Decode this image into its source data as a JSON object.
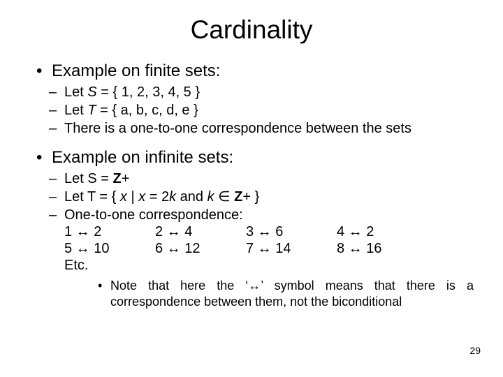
{
  "title": "Cardinality",
  "bullet1": "Example on finite sets:",
  "sub1a_pre": "Let ",
  "sub1a_S": "S",
  "sub1a_post": " = { 1, 2, 3, 4, 5 }",
  "sub1b_pre": "Let ",
  "sub1b_T": "T",
  "sub1b_post": " = { a, b, c, d, e }",
  "sub1c": "There is a one-to-one correspondence between the sets",
  "bullet2": "Example on infinite sets:",
  "sub2a_pre": "Let S = ",
  "sub2a_Z": "Z",
  "sub2a_post": "+",
  "sub2b_pre": "Let T = { ",
  "sub2b_x": "x",
  "sub2b_mid1": " | ",
  "sub2b_x2": "x",
  "sub2b_mid2": " = 2",
  "sub2b_k": "k",
  "sub2b_mid3": " and ",
  "sub2b_k2": "k",
  "sub2b_in": " ∈ ",
  "sub2b_Z": "Z",
  "sub2b_post": "+ }",
  "sub2c": "One-to-one correspondence:",
  "map": {
    "r1c1": "1 ↔ 2",
    "r1c2": "2 ↔ 4",
    "r1c3": "3 ↔ 6",
    "r1c4": "4 ↔ 2",
    "r2c1": "5 ↔ 10",
    "r2c2": "6 ↔ 12",
    "r2c3": "7 ↔ 14",
    "r2c4": "8 ↔ 16"
  },
  "etc": "Etc.",
  "note": "Note that here the ‘↔’ symbol means that there is a correspondence between them, not the biconditional",
  "page": "29"
}
